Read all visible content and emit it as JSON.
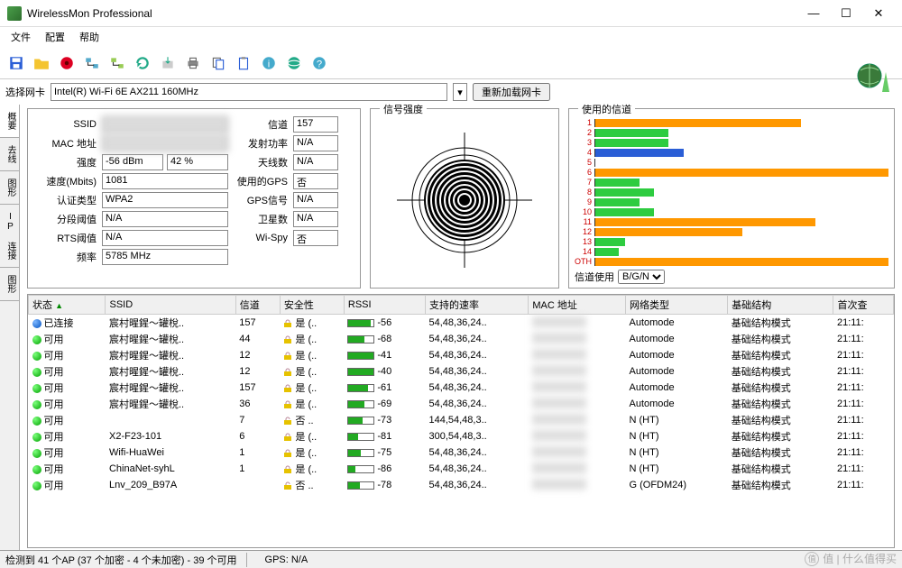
{
  "window": {
    "title": "WirelessMon Professional"
  },
  "menu": {
    "file": "文件",
    "config": "配置",
    "help": "帮助"
  },
  "toolbar_icons": [
    "save",
    "folder",
    "record",
    "net1",
    "net2",
    "refresh",
    "export",
    "print",
    "copy",
    "clipboard",
    "about",
    "globe-small",
    "help-q"
  ],
  "selector": {
    "label": "选择网卡",
    "adapter": "Intel(R) Wi-Fi 6E AX211 160MHz",
    "reload": "重新加载网卡"
  },
  "side_tabs": [
    "概要",
    "去线",
    "图形",
    "IP 连接",
    "图形"
  ],
  "info": {
    "ssid_label": "SSID",
    "ssid": "",
    "channel_label": "信道",
    "channel": "157",
    "mac_label": "MAC 地址",
    "mac": "",
    "txpower_label": "发射功率",
    "txpower": "N/A",
    "strength_label": "强度",
    "strength_dbm": "-56 dBm",
    "strength_pct": "42 %",
    "antennas_label": "天线数",
    "antennas": "N/A",
    "speed_label": "速度(Mbits)",
    "speed": "1081",
    "gps_used_label": "使用的GPS",
    "gps_used": "否",
    "auth_label": "认证类型",
    "auth": "WPA2",
    "gps_signal_label": "GPS信号",
    "gps_signal": "N/A",
    "frag_label": "分段阈值",
    "frag": "N/A",
    "sats_label": "卫星数",
    "sats": "N/A",
    "rts_label": "RTS阈值",
    "rts": "N/A",
    "wispy_label": "Wi-Spy",
    "wispy": "否",
    "freq_label": "频率",
    "freq": "5785 MHz"
  },
  "panel_titles": {
    "signal": "信号强度",
    "channels": "使用的信道"
  },
  "chart_data": {
    "type": "bar",
    "title": "使用的信道",
    "categories": [
      "1",
      "2",
      "3",
      "4",
      "5",
      "6",
      "7",
      "8",
      "9",
      "10",
      "11",
      "12",
      "13",
      "14",
      "OTH"
    ],
    "series": [
      {
        "name": "orange",
        "color": "#ff9800",
        "values": [
          70,
          0,
          0,
          0,
          0,
          100,
          0,
          0,
          0,
          0,
          75,
          50,
          0,
          0,
          100
        ]
      },
      {
        "name": "green",
        "color": "#2ecc40",
        "values": [
          0,
          25,
          25,
          0,
          0,
          0,
          15,
          20,
          15,
          20,
          0,
          0,
          10,
          8,
          0
        ]
      },
      {
        "name": "blue",
        "color": "#2a5ed6",
        "values": [
          0,
          0,
          0,
          30,
          0,
          0,
          0,
          0,
          0,
          0,
          0,
          0,
          0,
          0,
          0
        ]
      }
    ],
    "xlabel": "信道",
    "ylabel": "",
    "ylim": [
      0,
      100
    ]
  },
  "channel_mode": {
    "label": "信道使用",
    "value": "B/G/N"
  },
  "columns": {
    "status": "状态",
    "ssid": "SSID",
    "channel": "信道",
    "security": "安全性",
    "rssi": "RSSI",
    "rates": "支持的速率",
    "mac": "MAC 地址",
    "nettype": "网络类型",
    "infra": "基础结构",
    "first": "首次查"
  },
  "rows": [
    {
      "status": "已连接",
      "dot": "blue",
      "ssid": "宸村暒鍟〜罐梲..",
      "ch": "157",
      "sec": "是 (..",
      "rssi": -56,
      "rates": "54,48,36,24..",
      "nt": "Automode",
      "infra": "基础结构模式",
      "first": "21:11:"
    },
    {
      "status": "可用",
      "dot": "green",
      "ssid": "宸村暒鍟〜罐梲..",
      "ch": "44",
      "sec": "是 (..",
      "rssi": -68,
      "rates": "54,48,36,24..",
      "nt": "Automode",
      "infra": "基础结构模式",
      "first": "21:11:"
    },
    {
      "status": "可用",
      "dot": "green",
      "ssid": "宸村暒鍟〜罐梲..",
      "ch": "12",
      "sec": "是 (..",
      "rssi": -41,
      "rates": "54,48,36,24..",
      "nt": "Automode",
      "infra": "基础结构模式",
      "first": "21:11:"
    },
    {
      "status": "可用",
      "dot": "green",
      "ssid": "宸村暒鍟〜罐梲..",
      "ch": "12",
      "sec": "是 (..",
      "rssi": -40,
      "rates": "54,48,36,24..",
      "nt": "Automode",
      "infra": "基础结构模式",
      "first": "21:11:"
    },
    {
      "status": "可用",
      "dot": "green",
      "ssid": "宸村暒鍟〜罐梲..",
      "ch": "157",
      "sec": "是 (..",
      "rssi": -61,
      "rates": "54,48,36,24..",
      "nt": "Automode",
      "infra": "基础结构模式",
      "first": "21:11:"
    },
    {
      "status": "可用",
      "dot": "green",
      "ssid": "宸村暒鍟〜罐梲..",
      "ch": "36",
      "sec": "是 (..",
      "rssi": -69,
      "rates": "54,48,36,24..",
      "nt": "Automode",
      "infra": "基础结构模式",
      "first": "21:11:"
    },
    {
      "status": "可用",
      "dot": "green",
      "ssid": "",
      "ch": "7",
      "sec": "否 ..",
      "rssi": -73,
      "rates": "144,54,48,3..",
      "nt": "N (HT)",
      "infra": "基础结构模式",
      "first": "21:11:"
    },
    {
      "status": "可用",
      "dot": "green",
      "ssid": "X2-F23-101",
      "ch": "6",
      "sec": "是 (..",
      "rssi": -81,
      "rates": "300,54,48,3..",
      "nt": "N (HT)",
      "infra": "基础结构模式",
      "first": "21:11:"
    },
    {
      "status": "可用",
      "dot": "green",
      "ssid": "Wifi-HuaWei",
      "ch": "1",
      "sec": "是 (..",
      "rssi": -75,
      "rates": "54,48,36,24..",
      "nt": "N (HT)",
      "infra": "基础结构模式",
      "first": "21:11:"
    },
    {
      "status": "可用",
      "dot": "green",
      "ssid": "ChinaNet-syhL",
      "ch": "1",
      "sec": "是 (..",
      "rssi": -86,
      "rates": "54,48,36,24..",
      "nt": "N (HT)",
      "infra": "基础结构模式",
      "first": "21:11:"
    },
    {
      "status": "可用",
      "dot": "green",
      "ssid": "Lnv_209_B97A",
      "ch": "",
      "sec": "否 ..",
      "rssi": -78,
      "rates": "54,48,36,24..",
      "nt": "G (OFDM24)",
      "infra": "基础结构模式",
      "first": "21:11:"
    }
  ],
  "statusbar": {
    "aps": "检测到 41 个AP (37 个加密 - 4 个未加密) - 39 个可用",
    "gps": "GPS: N/A"
  },
  "watermark": "值 | 什么值得买"
}
